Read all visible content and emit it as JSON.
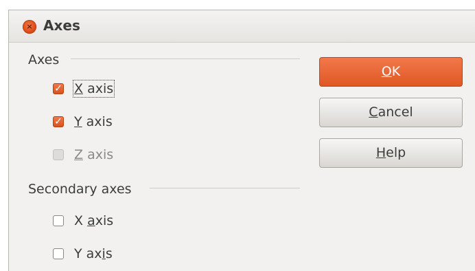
{
  "window": {
    "title": "Axes",
    "close_glyph": "×"
  },
  "axes_group": {
    "label": "Axes",
    "items": [
      {
        "pre": "",
        "mnemonic": "X",
        "post": " axis",
        "checked": true,
        "disabled": false,
        "focused": true
      },
      {
        "pre": "",
        "mnemonic": "Y",
        "post": " axis",
        "checked": true,
        "disabled": false,
        "focused": false
      },
      {
        "pre": "",
        "mnemonic": "Z",
        "post": " axis",
        "checked": false,
        "disabled": true,
        "focused": false
      }
    ]
  },
  "secondary_group": {
    "label": "Secondary axes",
    "items": [
      {
        "pre": "X ",
        "mnemonic": "a",
        "post": "xis",
        "checked": false,
        "disabled": false
      },
      {
        "pre": "Y ax",
        "mnemonic": "i",
        "post": "s",
        "checked": false,
        "disabled": false
      }
    ]
  },
  "buttons": {
    "ok": {
      "mnemonic": "O",
      "rest": "K"
    },
    "cancel": {
      "mnemonic": "C",
      "rest": "ancel"
    },
    "help": {
      "mnemonic": "H",
      "rest": "elp"
    }
  },
  "colors": {
    "accent": "#df5824",
    "dialog_bg": "#f2f1f0",
    "text": "#3c3c3c"
  },
  "icons": {
    "close": "close-icon",
    "check": "checkmark-icon"
  }
}
